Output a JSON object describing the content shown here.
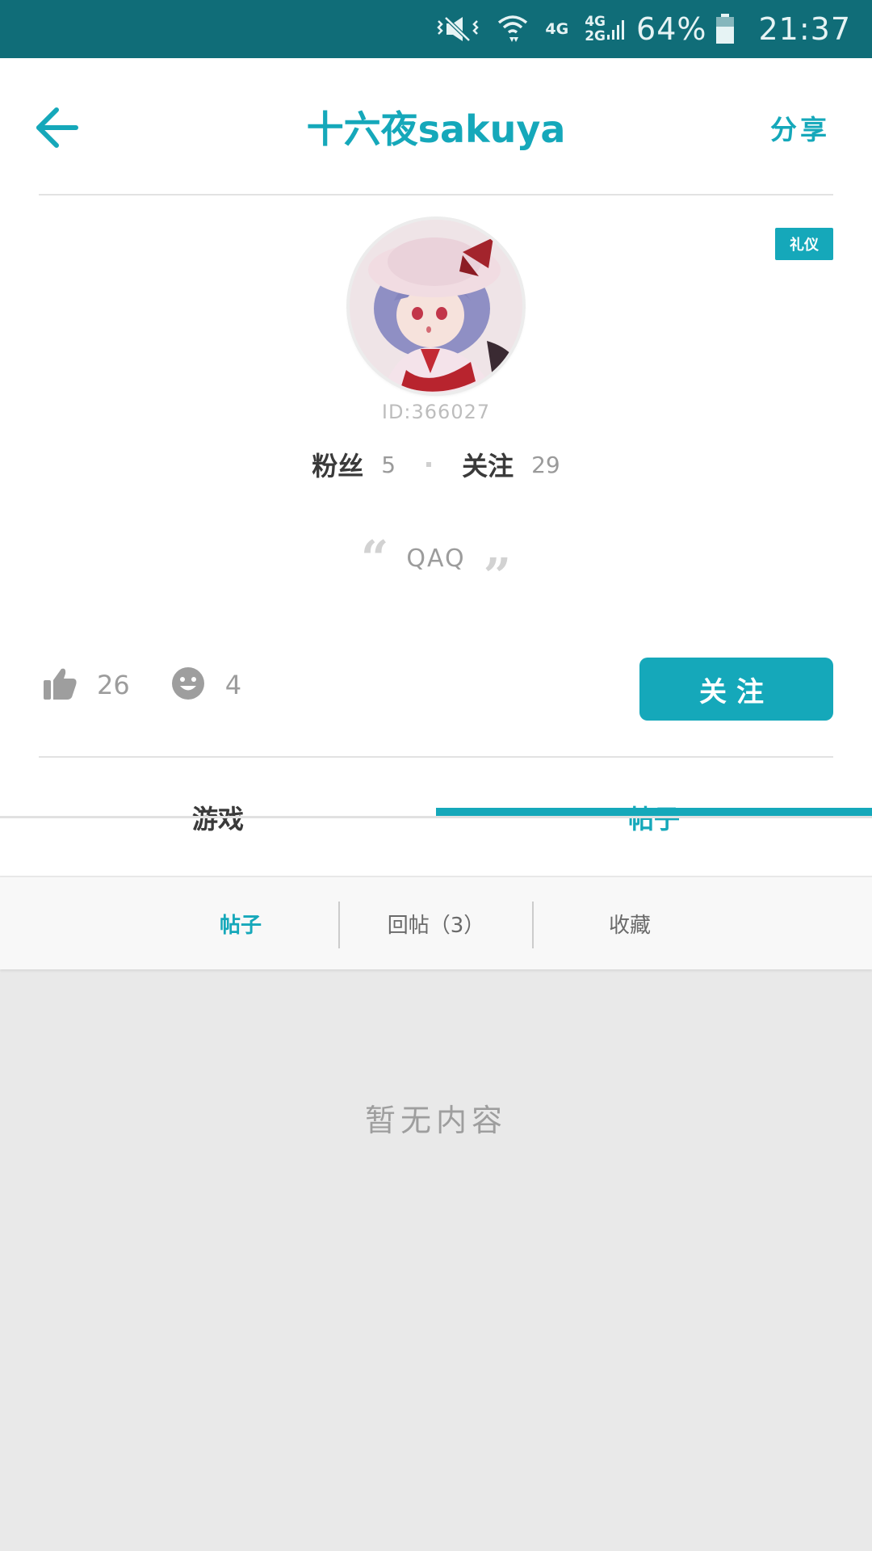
{
  "status_bar": {
    "network_top": "4G",
    "network_stack_top": "4G",
    "network_stack_bottom": "2G",
    "battery": "64%",
    "time": "21:37",
    "icons": [
      "vibrate-mute-icon",
      "wifi-icon",
      "signal-icon",
      "battery-icon"
    ]
  },
  "header": {
    "title": "十六夜sakuya",
    "share_label": "分享",
    "back_icon": "arrow-left-icon"
  },
  "profile": {
    "badge": "礼仪",
    "id_text": "ID:366027",
    "fans_label": "粉丝",
    "fans_count": "5",
    "following_label": "关注",
    "following_count": "29",
    "signature": "QAQ",
    "likes_count": "26",
    "smile_count": "4",
    "follow_button": "关注"
  },
  "tabs": [
    {
      "label": "游戏",
      "active": false
    },
    {
      "label": "帖子",
      "active": true
    }
  ],
  "subtabs": [
    {
      "label": "帖子",
      "active": true
    },
    {
      "label": "回帖（3）",
      "active": false
    },
    {
      "label": "收藏",
      "active": false
    }
  ],
  "empty_text": "暂无内容",
  "colors": {
    "accent": "#15a8ba",
    "status_bar": "#106d78",
    "page_bg": "#e9e9e9"
  }
}
